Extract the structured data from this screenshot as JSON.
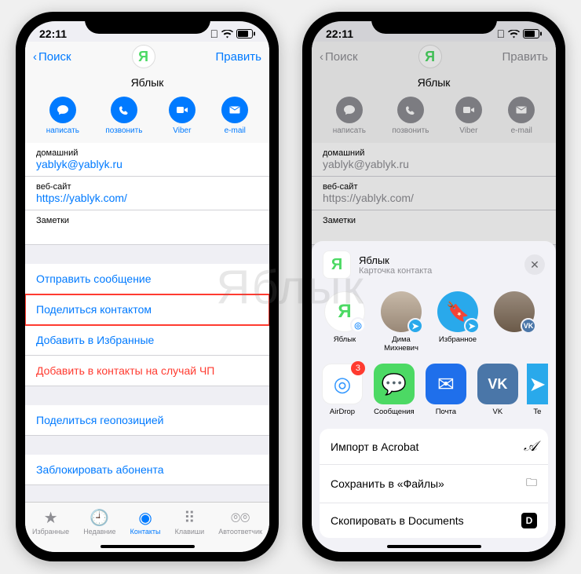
{
  "status": {
    "time": "22:11"
  },
  "nav": {
    "back": "Поиск",
    "edit": "Править"
  },
  "contact": {
    "initial": "Я",
    "name": "Яблык",
    "actions": [
      {
        "label": "написать",
        "icon": "message"
      },
      {
        "label": "позвонить",
        "icon": "phone"
      },
      {
        "label": "Viber",
        "icon": "video"
      },
      {
        "label": "e-mail",
        "icon": "mail"
      }
    ],
    "fields": [
      {
        "label": "домашний",
        "value": "yablyk@yablyk.ru"
      },
      {
        "label": "веб-сайт",
        "value": "https://yablyk.com/"
      }
    ],
    "notes_label": "Заметки"
  },
  "rows": {
    "send_message": "Отправить сообщение",
    "share_contact": "Поделиться контактом",
    "add_fav": "Добавить в Избранные",
    "add_emergency": "Добавить в контакты на случай ЧП",
    "share_location": "Поделиться геопозицией",
    "block": "Заблокировать абонента"
  },
  "tabs": [
    {
      "label": "Избранные",
      "icon": "★"
    },
    {
      "label": "Недавние",
      "icon": "🕘"
    },
    {
      "label": "Контакты",
      "icon": "◉",
      "active": true
    },
    {
      "label": "Клавиши",
      "icon": "⠿"
    },
    {
      "label": "Автоответчик",
      "icon": "⌾"
    }
  ],
  "sheet": {
    "title": "Яблык",
    "subtitle": "Карточка контакта",
    "people": [
      {
        "label": "Яблык",
        "type": "initial",
        "val": "Я",
        "badge": "airdrop"
      },
      {
        "label": "Дима Михневич",
        "type": "photo",
        "badge": "telegram"
      },
      {
        "label": "Избранное",
        "type": "telegram",
        "badge": "telegram"
      },
      {
        "label": "",
        "type": "photo2",
        "badge": "vk"
      }
    ],
    "apps": [
      {
        "label": "AirDrop",
        "color": "#fff",
        "icon": "airdrop",
        "badge": "3"
      },
      {
        "label": "Сообщения",
        "color": "#4cd964",
        "icon": "msg"
      },
      {
        "label": "Почта",
        "color": "#1f6feb",
        "icon": "mail"
      },
      {
        "label": "VK",
        "color": "#4a76a8",
        "icon": "vk"
      },
      {
        "label": "Te",
        "color": "#29a9eb",
        "icon": "tg",
        "cut": true
      }
    ],
    "actions": [
      {
        "label": "Импорт в Acrobat",
        "icon": "acrobat"
      },
      {
        "label": "Сохранить в «Файлы»",
        "icon": "folder"
      },
      {
        "label": "Скопировать в Documents",
        "icon": "docs"
      }
    ]
  }
}
